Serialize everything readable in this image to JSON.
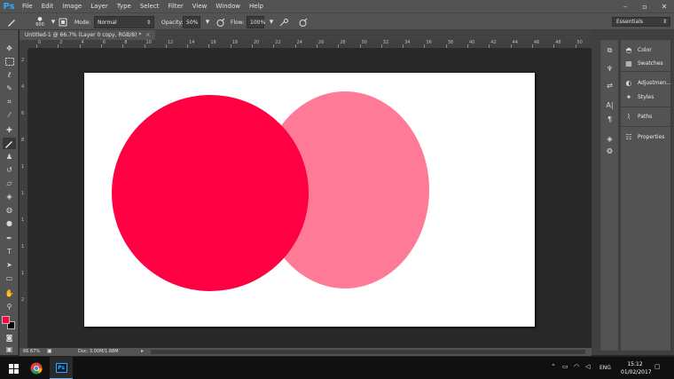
{
  "app": {
    "logo": "Ps"
  },
  "menu": [
    "File",
    "Edit",
    "Image",
    "Layer",
    "Type",
    "Select",
    "Filter",
    "View",
    "Window",
    "Help"
  ],
  "window_controls": {
    "minimize": "–",
    "maximize": "▫",
    "close": "✕"
  },
  "options": {
    "brush_size": "600",
    "mode_label": "Mode:",
    "mode_value": "Normal",
    "opacity_label": "Opacity:",
    "opacity_value": "50%",
    "flow_label": "Flow:",
    "flow_value": "100%"
  },
  "workspace": {
    "value": "Essentials"
  },
  "document_tab": {
    "title": "Untitled-1 @ 66.7% (Layer 0 copy, RGB/8) *",
    "close": "×"
  },
  "ruler_top": [
    "0",
    "2",
    "4",
    "6",
    "8",
    "10",
    "12",
    "14",
    "16",
    "18",
    "20",
    "22",
    "24",
    "26",
    "28",
    "30",
    "32",
    "34",
    "36",
    "38",
    "40",
    "42",
    "44",
    "46",
    "48",
    "50",
    "52"
  ],
  "ruler_left": [
    "2",
    "4",
    "6",
    "8",
    "1",
    "1",
    "1",
    "1",
    "1",
    "2"
  ],
  "canvas": {
    "background": "#ffffff",
    "circles": [
      {
        "name": "light-pink-circle",
        "color": "#ff7a96"
      },
      {
        "name": "red-circle",
        "color": "#ff0042"
      }
    ]
  },
  "colors": {
    "foreground": "#ff0042",
    "background": "#000000"
  },
  "status": {
    "zoom": "66.67%",
    "doc": "Doc: 3.00M/1.68M",
    "arrow": "▸"
  },
  "panels": [
    {
      "icon": "color-panel-icon",
      "label": "Color"
    },
    {
      "icon": "swatches-panel-icon",
      "label": "Swatches"
    },
    {
      "icon": "adjustments-panel-icon",
      "label": "Adjustmen..."
    },
    {
      "icon": "styles-panel-icon",
      "label": "Styles"
    },
    {
      "icon": "paths-panel-icon",
      "label": "Paths"
    },
    {
      "icon": "properties-panel-icon",
      "label": "Properties"
    }
  ],
  "taskbar": {
    "language": "ENG",
    "time": "15:12",
    "date": "01/02/2017"
  }
}
